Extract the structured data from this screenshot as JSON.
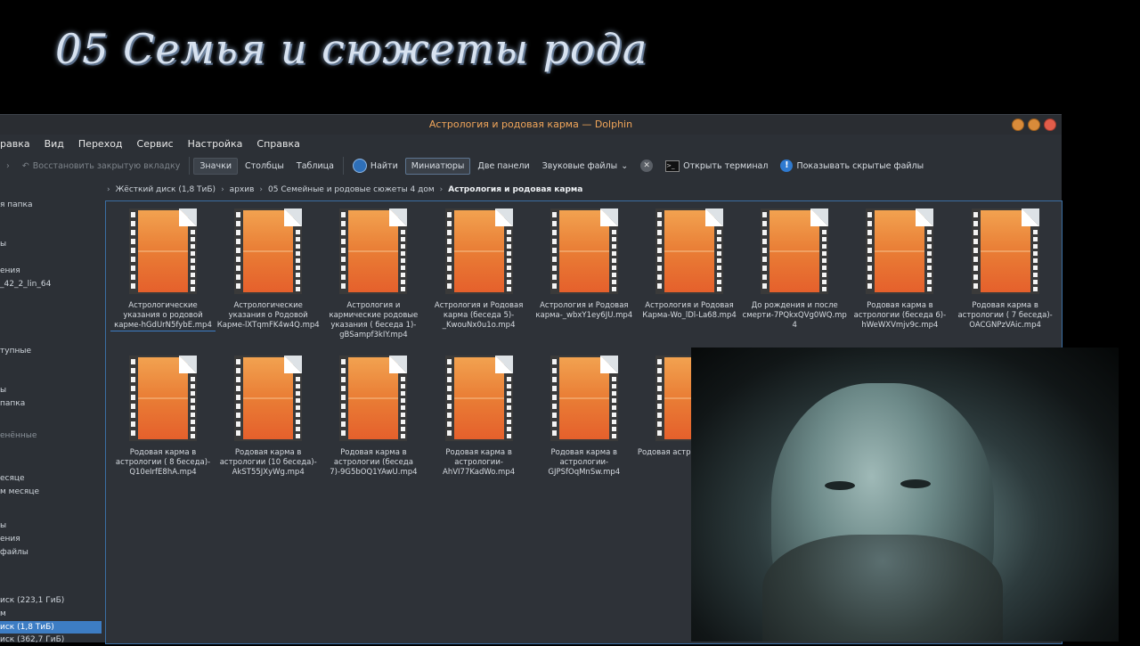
{
  "banner": {
    "text": "05 Семья и сюжеты рода"
  },
  "window": {
    "title": "Астрология и родовая карма — Dolphin",
    "menu": [
      "равка",
      "Вид",
      "Переход",
      "Сервис",
      "Настройка",
      "Справка"
    ],
    "toolbar": {
      "restore_tab": "Восстановить закрытую вкладку",
      "icons_view": "Значки",
      "columns_view": "Столбцы",
      "table_view": "Таблица",
      "find": "Найти",
      "thumbnails": "Миниатюры",
      "split": "Две панели",
      "audio_files": "Звуковые файлы",
      "terminal": "Открыть терминал",
      "show_hidden": "Показывать скрытые файлы"
    },
    "breadcrumb": [
      "Жёсткий диск (1,8 ТиБ)",
      "архив",
      "05 Семейные и родовые сюжеты 4 дом",
      "Астрология и родовая карма"
    ],
    "sidebar": [
      "я папка",
      "ы",
      "ения",
      "_42_2_lin_64",
      "тупные",
      "ы",
      "папка",
      "енённые",
      "есяце",
      "м месяце",
      "ы",
      "ения",
      "файлы",
      "иск (223,1 ГиБ)",
      "м",
      "иск (1,8 ТиБ)",
      "иск (362,7 ГиБ)"
    ],
    "files": [
      "Астрологические указания о родовой карме-hGdUrN5fybE.mp4",
      "Астрологические указания о Родовой Карме-lXTqmFK4w4Q.mp4",
      "Астрология и кармические родовые указания ( беседа 1)-gBSampf3kIY.mp4",
      "Астрология и Родовая карма (беседа 5)-_KwouNx0u1o.mp4",
      "Астрология и Родовая карма-_wbxY1ey6JU.mp4",
      "Астрология и Родовая Карма-Wo_lDl-La68.mp4",
      "До рождения и после смерти-7PQkxQVg0WQ.mp4",
      "Родовая карма  в астрологии (беседа 6)-hWeWXVmjv9c.mp4",
      "Родовая карма в астрологии ( 7 беседа)-OACGNPzVAic.mp4",
      "Родовая карма в астрологии ( 8 беседа)-Q10eIrfE8hA.mp4",
      "Родовая карма в астрологии (10 беседа)-AkST55JXyWg.mp4",
      "Родовая карма в астрологии (беседа 7)-9G5bOQ1YAwU.mp4",
      "Родовая карма в астрологии-AhVI77KadWo.mp4",
      "Родовая карма в астрологии-GJPSfOqMnSw.mp4",
      "Родовая астрологии-I( mp"
    ]
  }
}
